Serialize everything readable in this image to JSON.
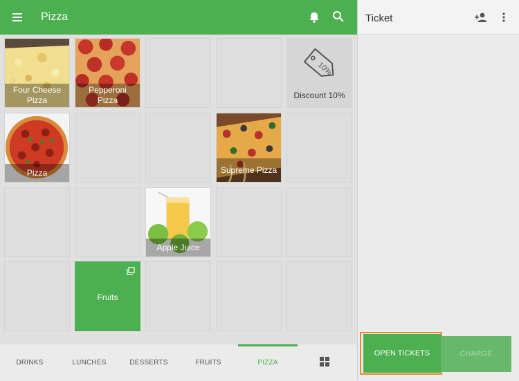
{
  "header": {
    "title": "Pizza",
    "menu_icon": "menu-icon",
    "bell_icon": "bell-icon",
    "search_icon": "search-icon"
  },
  "tiles": [
    {
      "label": "Four Cheese Pizza"
    },
    {
      "label": "Pepperoni Pizza"
    },
    {
      "label": "Discount 10%",
      "tag_text": "10%"
    },
    {
      "label": "Pizza"
    },
    {
      "label": "Supreme Pizza"
    },
    {
      "label": "Apple Juice"
    },
    {
      "label": "Fruits"
    }
  ],
  "tabs": [
    {
      "label": "DRINKS"
    },
    {
      "label": "LUNCHES"
    },
    {
      "label": "DESSERTS"
    },
    {
      "label": "FRUITS"
    },
    {
      "label": "PIZZA",
      "active": true
    }
  ],
  "ticket": {
    "title": "Ticket",
    "add_person_icon": "person-add-icon",
    "more_icon": "more-vert-icon"
  },
  "actions": {
    "open_tickets": "OPEN TICKETS",
    "charge": "CHARGE"
  },
  "colors": {
    "brand": "#4caf50",
    "highlight": "#e48b2b"
  }
}
